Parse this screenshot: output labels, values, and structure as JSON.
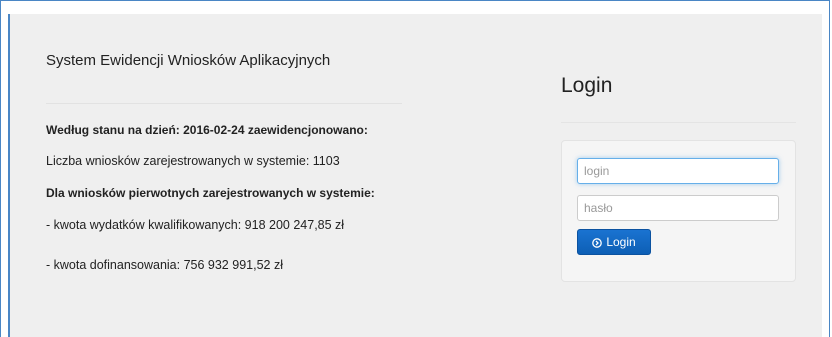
{
  "info": {
    "title": "System Ewidencji Wniosków Aplikacyjnych",
    "status_line": "Według stanu na dzień: 2016-02-24 zaewidencjonowano:",
    "applications_count": "Liczba wniosków zarejestrowanych w systemie: 1103",
    "primary_header": "Dla wniosków pierwotnych zarejestrowanych w systemie:",
    "eligible_expenses": "- kwota wydatków kwalifikowanych: 918 200 247,85 zł",
    "funding_amount": "- kwota dofinansowania: 756 932 991,52 zł"
  },
  "login": {
    "heading": "Login",
    "login_placeholder": "login",
    "password_placeholder": "hasło",
    "button_label": "Login",
    "button_icon": "circle-arrow-icon"
  },
  "colors": {
    "accent": "#4a86c5",
    "button": "#0d5fb5",
    "background": "#efefef"
  }
}
